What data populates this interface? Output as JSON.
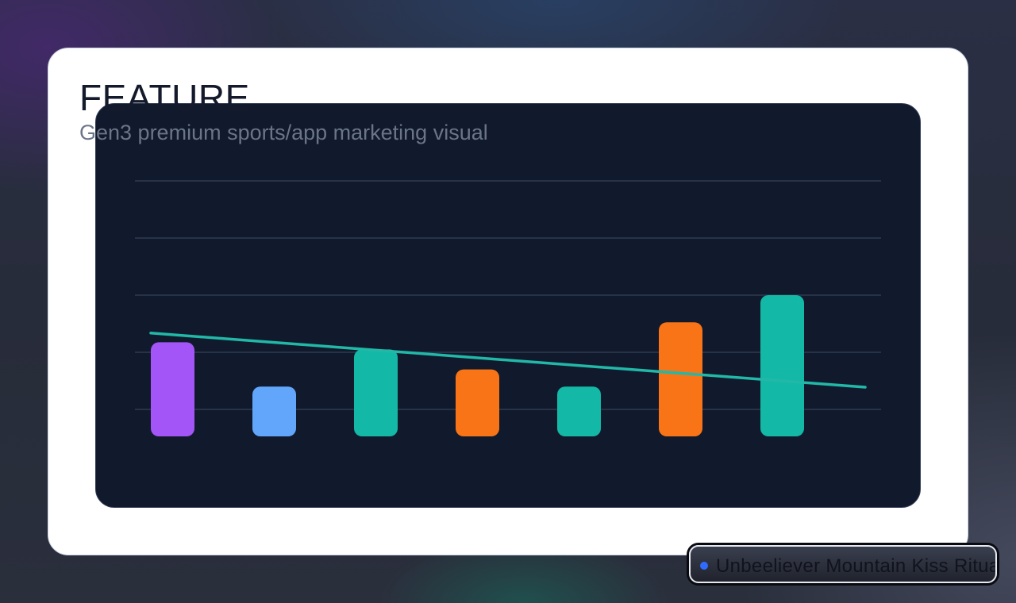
{
  "card": {
    "title": "FEATURE",
    "subtitle": "Gen3 premium sports/app marketing visual"
  },
  "badge": {
    "text": "Unbeeliever Mountain Kiss Ritual Gem",
    "dot_color": "#2f6bff"
  },
  "colors": {
    "panel_bg": "#111a2c",
    "grid": "#2e3b52",
    "trend": "#22b8a8"
  },
  "chart_data": {
    "type": "bar",
    "title": "",
    "xlabel": "",
    "ylabel": "",
    "categories": [
      "",
      "",
      "",
      "",
      "",
      "",
      ""
    ],
    "values": [
      38.5,
      23,
      36,
      29,
      23,
      45.5,
      55
    ],
    "bar_colors": [
      "#a455f7",
      "#62a6fb",
      "#14b8a6",
      "#f97416",
      "#14b8a6",
      "#f97416",
      "#14b8a6"
    ],
    "ylim": [
      0,
      90
    ],
    "gridlines": [
      15,
      35,
      55,
      75,
      95
    ],
    "grid": true,
    "trend_line": {
      "start": 42,
      "end": 22.5,
      "color": "#22b8a8"
    }
  }
}
